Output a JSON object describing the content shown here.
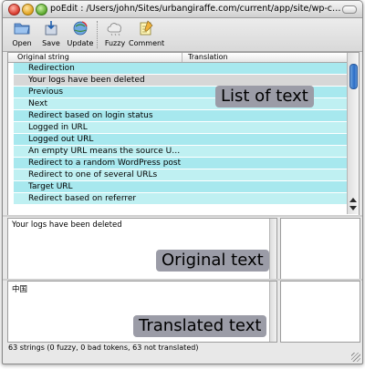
{
  "window": {
    "title": "poEdit : /Users/john/Sites/urbangiraffe.com/current/app/site/wp-cont..."
  },
  "toolbar": {
    "buttons": [
      {
        "label": "Open",
        "icon": "folder-open-icon"
      },
      {
        "label": "Save",
        "icon": "save-icon"
      },
      {
        "label": "Update",
        "icon": "update-globe-icon"
      },
      {
        "label": "Fuzzy",
        "icon": "fuzzy-cloud-icon"
      },
      {
        "label": "Comment",
        "icon": "comment-notepad-icon"
      }
    ]
  },
  "list": {
    "columns": [
      "Original string",
      "Translation"
    ],
    "rows": [
      {
        "original": "Redirection",
        "translation": "",
        "selected": false
      },
      {
        "original": "Your logs have been deleted",
        "translation": "",
        "selected": true
      },
      {
        "original": "Previous",
        "translation": "",
        "selected": false
      },
      {
        "original": "Next",
        "translation": "",
        "selected": false
      },
      {
        "original": "Redirect based on login status",
        "translation": "",
        "selected": false
      },
      {
        "original": "Logged in URL",
        "translation": "",
        "selected": false
      },
      {
        "original": "Logged out URL",
        "translation": "",
        "selected": false
      },
      {
        "original": "An empty URL means the source URL is ...",
        "translation": "",
        "selected": false
      },
      {
        "original": "Redirect to a random WordPress post",
        "translation": "",
        "selected": false
      },
      {
        "original": "Redirect to one of several URLs",
        "translation": "",
        "selected": false
      },
      {
        "original": "Target URL",
        "translation": "",
        "selected": false
      },
      {
        "original": "Redirect based on referrer",
        "translation": "",
        "selected": false
      }
    ],
    "callout": "List of text"
  },
  "original_pane": {
    "text": "Your logs have been deleted",
    "callout": "Original text"
  },
  "translated_pane": {
    "text": "中国",
    "callout": "Translated text"
  },
  "status": {
    "text": "63 strings (0 fuzzy, 0 bad tokens, 63 not translated)"
  },
  "colors": {
    "row_bg": "#a7e8ee",
    "row_selected_bg": "#d7d7d7",
    "callout_bg": "#9b9ca7",
    "scroll_thumb": "#2a6dc7"
  }
}
